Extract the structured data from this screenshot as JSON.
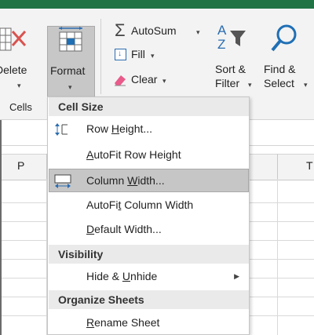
{
  "ribbon": {
    "delete_label": "Delete",
    "format_label": "Format",
    "cells_group_label": "Cells",
    "autosum_label": "AutoSum",
    "fill_label": "Fill",
    "clear_label": "Clear",
    "sort_label_1": "Sort &",
    "sort_label_2": "Filter",
    "find_label_1": "Find &",
    "find_label_2": "Select",
    "dropdown_glyph": "▾",
    "colors": {
      "title_bar": "#217346",
      "sigma": "#444444",
      "az_blue": "#2b6cb0",
      "search_blue": "#1f6fb5",
      "clear_pink": "#e85b8a"
    }
  },
  "sheet": {
    "column_headers": [
      "P",
      "T"
    ]
  },
  "menu": {
    "sections": [
      {
        "header": "Cell Size",
        "items": [
          {
            "pre": "Row ",
            "key": "H",
            "post": "eight...",
            "icon": "row-height-icon"
          },
          {
            "pre": "",
            "key": "A",
            "post": "utoFit Row Height",
            "icon": ""
          },
          {
            "pre": "Column ",
            "key": "W",
            "post": "idth...",
            "icon": "column-width-icon",
            "selected": true
          },
          {
            "pre": "AutoFi",
            "key": "t",
            "post": " Column Width",
            "icon": ""
          },
          {
            "pre": "",
            "key": "D",
            "post": "efault Width...",
            "icon": ""
          }
        ]
      },
      {
        "header": "Visibility",
        "items": [
          {
            "pre": "Hide & ",
            "key": "U",
            "post": "nhide",
            "icon": "",
            "submenu": true
          }
        ]
      },
      {
        "header": "Organize Sheets",
        "items": [
          {
            "pre": "",
            "key": "R",
            "post": "ename Sheet",
            "icon": ""
          }
        ]
      }
    ]
  }
}
